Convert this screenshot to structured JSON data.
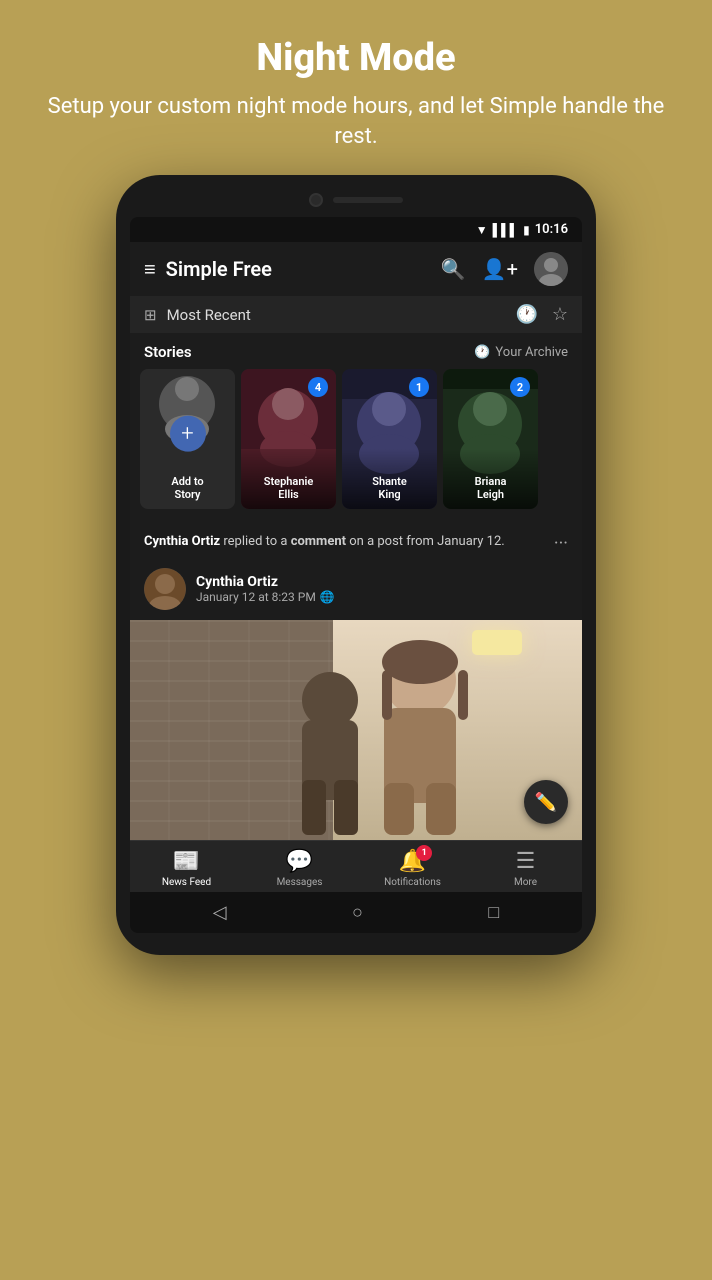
{
  "page": {
    "title": "Night Mode",
    "subtitle": "Setup your custom night mode hours, and let Simple handle the rest."
  },
  "status_bar": {
    "time": "10:16"
  },
  "app_bar": {
    "title": "Simple Free"
  },
  "filter": {
    "label": "Most Recent"
  },
  "stories": {
    "section_label": "Stories",
    "archive_label": "Your Archive",
    "add_story": {
      "button_label": "+",
      "name_line1": "Add to",
      "name_line2": "Story"
    },
    "items": [
      {
        "name": "Stephanie Ellis",
        "badge": "4"
      },
      {
        "name": "Shante King",
        "badge": "1"
      },
      {
        "name": "Briana Leigh",
        "badge": "2"
      }
    ]
  },
  "post": {
    "meta": "replied to a",
    "bold_word": "comment",
    "meta2": "on a post from January 12.",
    "author_name": "Cynthia Ortiz",
    "poster_name": "Cynthia Ortiz",
    "date": "January 12 at 8:23 PM",
    "globe_icon": "🌐"
  },
  "bottom_nav": {
    "items": [
      {
        "label": "News Feed",
        "icon": "📰",
        "active": true
      },
      {
        "label": "Messages",
        "icon": "💬",
        "active": false
      },
      {
        "label": "Notifications",
        "icon": "🔔",
        "active": false,
        "badge": "1"
      },
      {
        "label": "More",
        "icon": "☰",
        "active": false
      }
    ]
  },
  "fab": {
    "icon": "✏️"
  },
  "system_nav": {
    "back": "◁",
    "home": "○",
    "recent": "□"
  }
}
